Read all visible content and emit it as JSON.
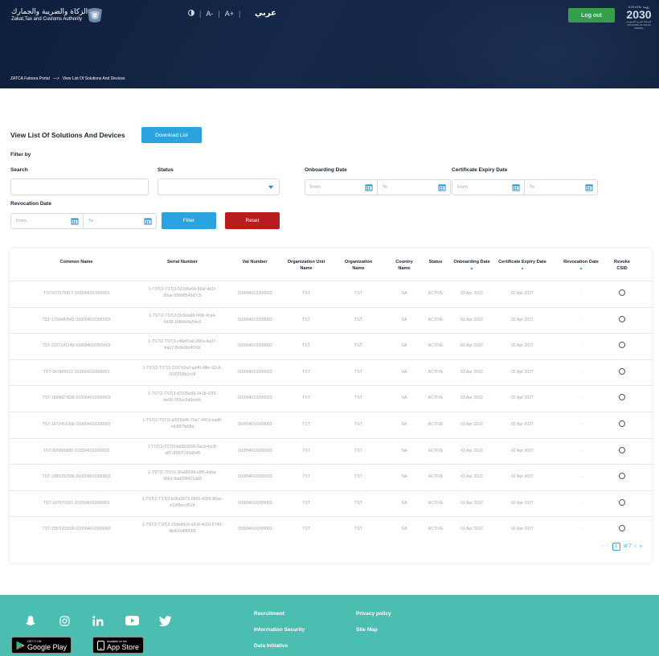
{
  "header": {
    "org_name_ar": "هيئة الزكاة والضريبة والجمارك",
    "org_name_en": "Zakat,Tax and Customs Authority",
    "contrast_icon": "contrast-icon",
    "font_decrease": "A-",
    "font_increase": "A+",
    "language_toggle": "عربي",
    "logout_label": "Log out",
    "vision_top": "VISION رؤيـة",
    "vision_year": "2030",
    "vision_sub": "المملكة العربية السعودية KINGDOM OF SAUDI ARABIA",
    "breadcrumb": {
      "root": "ZATCA Fatoora Portal",
      "arrow": "—>",
      "current": "View List Of Solutions And Devices"
    },
    "colors": {
      "header_bg": "#0e1f3c",
      "accent": "#2aa3de",
      "logout": "#36a843",
      "reset": "#b81d1d",
      "footer": "#4bbdb1"
    }
  },
  "page": {
    "title": "View List Of Solutions And Devices",
    "download_label": "Download List",
    "filter_by": "Filter by"
  },
  "filters": {
    "search_label": "Search",
    "status_label": "Status",
    "onboarding_label": "Onboarding Date",
    "expiry_label": "Certificate Expiry Date",
    "revocation_label": "Revocation Date",
    "from_placeholder": "From",
    "to_placeholder": "To",
    "filter_button": "Filter",
    "reset_button": "Reset"
  },
  "table": {
    "headers": {
      "common_name": "Common Name",
      "serial_number": "Serial Number",
      "vat_number": "Vat Number",
      "org_unit": "Organization Unit Name",
      "org_name": "Organization Name",
      "country": "Country Name",
      "status": "Status",
      "onboarding": "Onboarding Date",
      "expiry": "Certificate Expiry Date",
      "revocation": "Revocation Date",
      "revoke": "Revoke CSID"
    },
    "sort_icon": "sort-up-icon",
    "rows": [
      {
        "common_name": "TST-577676817-310094010300003",
        "serial_1": "1-TST|2-TST|3-531d6e6b-8daf-4b1f-",
        "serial_2": "89ae-558d8549d7c5",
        "vat": "310094010200003",
        "org_unit": "TST",
        "org_name": "TST",
        "country": "SA",
        "status": "ACTIVE",
        "onboarding": "03 Apr 2022",
        "expiry": "02 Apr 2027",
        "revocation": "-"
      },
      {
        "common_name": "TST-1760480545-310094010300003",
        "serial_1": "1-TST|2-TST|3-f3c9da88-f49b-4ca4-",
        "serial_2": "bd38-1bfb0e4a54e3",
        "vat": "310094010200003",
        "org_unit": "TST",
        "org_name": "TST",
        "country": "SA",
        "status": "ACTIVE",
        "onboarding": "03 Apr 2022",
        "expiry": "02 Apr 2027",
        "revocation": "-"
      },
      {
        "common_name": "TST-1227181149-310094010300003",
        "serial_1": "1-TST|2-TST|3-c4bdf7a6-288a-4a37-",
        "serial_2": "ba17-8c8e9fa4f20d",
        "vat": "310094010200003",
        "org_unit": "TST",
        "org_name": "TST",
        "country": "SA",
        "status": "ACTIVE",
        "onboarding": "03 Apr 2022",
        "expiry": "02 Apr 2027",
        "revocation": "-"
      },
      {
        "common_name": "TST-347809912-310094010300003",
        "serial_1": "1-TST|2-TST|3-315742a3-ad40-4fbc-92cb-",
        "serial_2": "f160158b1cc8",
        "vat": "310094010200003",
        "org_unit": "TST",
        "org_name": "TST",
        "country": "SA",
        "status": "ACTIVE",
        "onboarding": "03 Apr 2022",
        "expiry": "02 Apr 2027",
        "revocation": "-"
      },
      {
        "common_name": "TST-1899627838-310094010300003",
        "serial_1": "1-TST|2-TST|3-d7035e89-3418-42f3-",
        "serial_2": "be08-050cc5a0ee0c",
        "vat": "310094010200003",
        "org_unit": "TST",
        "org_name": "TST",
        "country": "SA",
        "status": "ACTIVE",
        "onboarding": "03 Apr 2022",
        "expiry": "02 Apr 2027",
        "revocation": "-"
      },
      {
        "common_name": "TST-1472451068-310094010300003",
        "serial_1": "1-TST|2-TST|3-af935d46-70a7-4451-bad8-",
        "serial_2": "efc887fa0ffa",
        "vat": "310094010200003",
        "org_unit": "TST",
        "org_name": "TST",
        "country": "SA",
        "status": "ACTIVE",
        "onboarding": "03 Apr 2022",
        "expiry": "02 Apr 2027",
        "revocation": "-"
      },
      {
        "common_name": "TST-505865880-310094010300003",
        "serial_1": "1-TST|2-TST|3-bd3b3668-2acd-4cc8-",
        "serial_2": "aff7-8987f7d4a548",
        "vat": "310094010200003",
        "org_unit": "TST",
        "org_name": "TST",
        "country": "SA",
        "status": "ACTIVE",
        "onboarding": "03 Apr 2022",
        "expiry": "02 Apr 2027",
        "revocation": "-"
      },
      {
        "common_name": "TST-1385292336-310094010300003",
        "serial_1": "1-TST|2-TST|3-36a86566-c8f5-4aba-",
        "serial_2": "96b1-8ad158431dd3",
        "vat": "310094010200003",
        "org_unit": "TST",
        "org_name": "TST",
        "country": "SA",
        "status": "ACTIVE",
        "onboarding": "03 Apr 2022",
        "expiry": "02 Apr 2027",
        "revocation": "-"
      },
      {
        "common_name": "TST-187570261-310094010300003",
        "serial_1": "1-TST|2-TST|3-b06a9673-08d3-4958-86ac-",
        "serial_2": "e1bf9bccf524",
        "vat": "310094010200003",
        "org_unit": "TST",
        "org_name": "TST",
        "country": "SA",
        "status": "ACTIVE",
        "onboarding": "03 Apr 2022",
        "expiry": "02 Apr 2027",
        "revocation": "-"
      },
      {
        "common_name": "TST-1957015509-310094010300003",
        "serial_1": "1-TST|2-TST|3-25de45c6-a2c8-4016-9745-",
        "serial_2": "db420a8f8088",
        "vat": "310094010200003",
        "org_unit": "TST",
        "org_name": "TST",
        "country": "SA",
        "status": "ACTIVE",
        "onboarding": "03 Apr 2022",
        "expiry": "02 Apr 2027",
        "revocation": "-"
      }
    ],
    "pagination": {
      "prev_first": "‹",
      "prev": "‹",
      "current_page": "1",
      "of_total": "of 7",
      "next": "›",
      "next_last": "»"
    }
  },
  "footer": {
    "social_icons": [
      "snapchat-icon",
      "instagram-icon",
      "linkedin-icon",
      "youtube-icon",
      "twitter-icon"
    ],
    "google_play_small": "GET IT ON",
    "google_play_big": "Google Play",
    "app_store_small": "Available on the",
    "app_store_big": "App Store",
    "links_col1": [
      "Recruitment",
      "Information Security",
      "Data Initiative"
    ],
    "links_col2": [
      "Privacy policy",
      "Site Map"
    ]
  }
}
